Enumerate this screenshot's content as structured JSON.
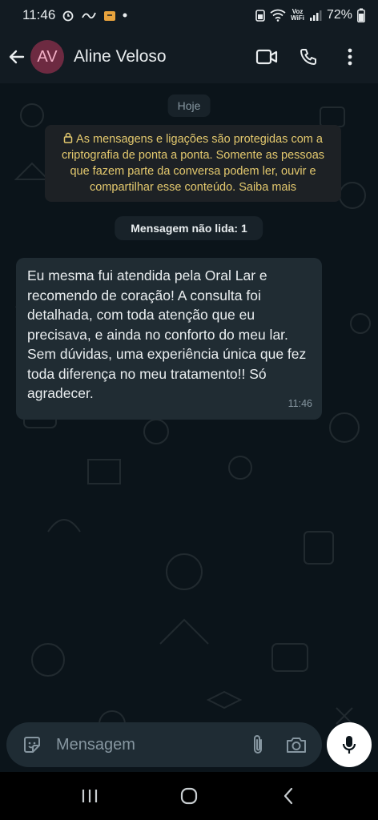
{
  "status_bar": {
    "time": "11:46",
    "network_label_top": "Voz",
    "network_label_bottom": "WiFi",
    "battery": "72%"
  },
  "header": {
    "avatar_initials": "AV",
    "contact_name": "Aline Veloso",
    "icons": [
      "back-arrow-icon",
      "video-call-icon",
      "phone-icon",
      "more-vert-icon"
    ]
  },
  "chat": {
    "date_chip": "Hoje",
    "encryption_notice": "As mensagens e ligações são protegidas com a criptografia de ponta a ponta. Somente as pessoas que fazem parte da conversa podem ler, ouvir e compartilhar esse conteúdo.",
    "encryption_link": "Saiba mais",
    "unread_label": "Mensagem não lida: 1",
    "messages": [
      {
        "text": "Eu mesma fui atendida pela Oral Lar e recomendo de coração! A consulta foi detalhada, com toda atenção que eu precisava, e ainda no conforto do meu lar. Sem dúvidas, uma experiência única que fez toda diferença no meu tratamento!! Só agradecer.",
        "time": "11:46",
        "direction": "incoming"
      }
    ]
  },
  "composer": {
    "placeholder": "Mensagem",
    "icons": [
      "sticker-icon",
      "attach-icon",
      "camera-icon",
      "mic-icon"
    ]
  },
  "nav_bar": {
    "icons": [
      "recents-icon",
      "home-icon",
      "back-icon"
    ]
  },
  "colors": {
    "background": "#0b141a",
    "header": "#121b22",
    "bubble_incoming": "#202c33",
    "notice_text": "#e4c96e",
    "avatar_bg": "#6d2a41"
  }
}
